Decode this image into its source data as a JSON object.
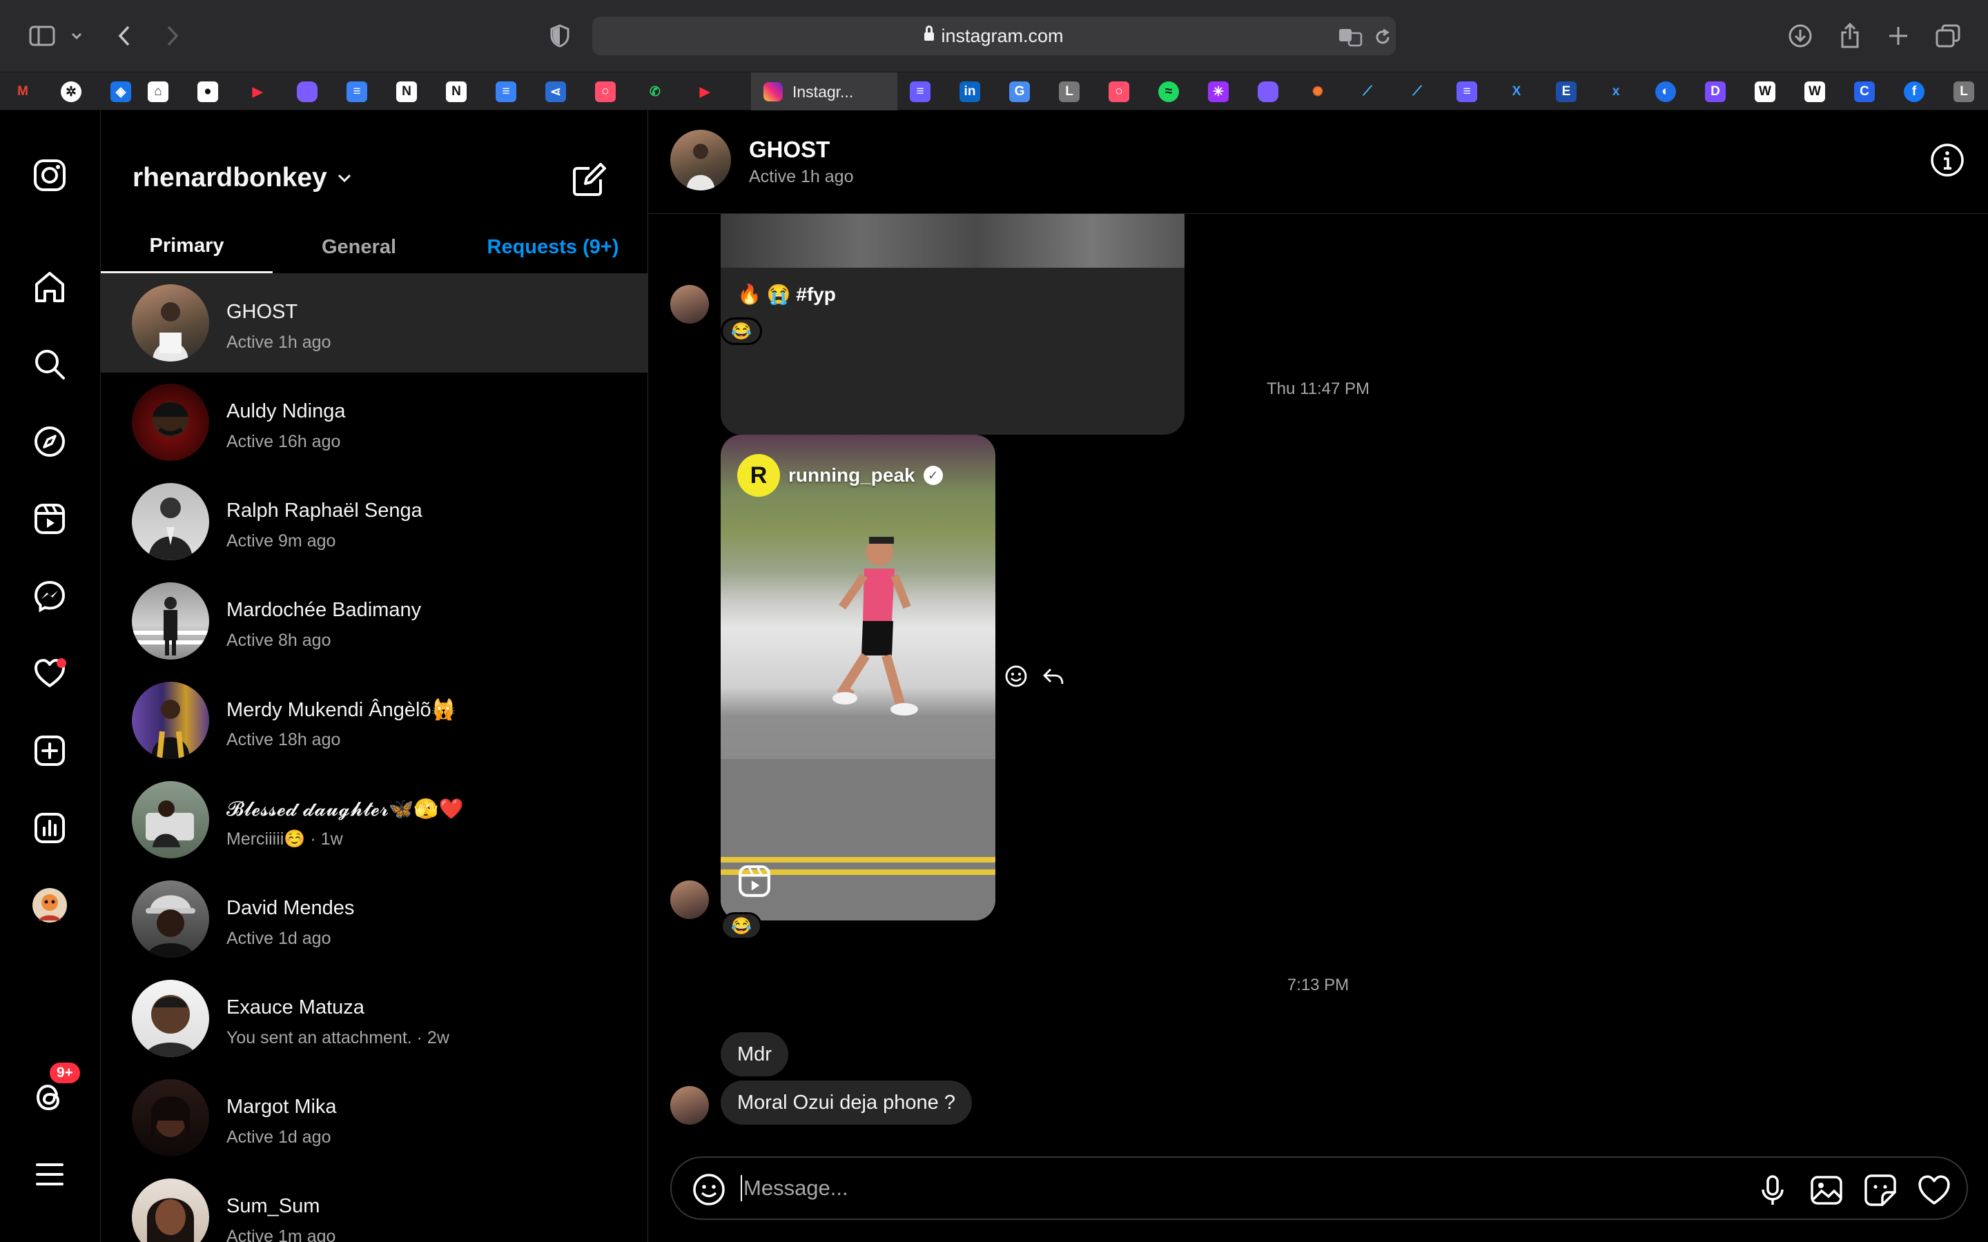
{
  "browser": {
    "url": "instagram.com",
    "active_tab_title": "Instagr..."
  },
  "nav": {
    "items": [
      "instagram-logo",
      "home",
      "search",
      "explore",
      "reels",
      "messages",
      "notifications",
      "create",
      "dashboard",
      "profile",
      "threads",
      "more"
    ],
    "threads_badge": "9+"
  },
  "inbox": {
    "username": "rhenardbonkey",
    "tabs": {
      "primary": "Primary",
      "general": "General",
      "requests": "Requests (9+)"
    },
    "conversations": [
      {
        "name": "GHOST",
        "status": "Active 1h ago"
      },
      {
        "name": "Auldy Ndinga",
        "status": "Active 16h ago"
      },
      {
        "name": "Ralph Raphaël Senga",
        "status": "Active 9m ago"
      },
      {
        "name": "Mardochée Badimany",
        "status": "Active 8h ago"
      },
      {
        "name": "Merdy Mukendi Ângèlõ🙀",
        "status": "Active 18h ago"
      },
      {
        "name": "𝓑𝓵𝓮𝓼𝓼𝓮𝓭 𝓭𝓪𝓾𝓰𝓱𝓽𝓮𝓻🦋🫣❤️",
        "status": "Merciiiii☺️ · 1w"
      },
      {
        "name": "David Mendes",
        "status": "Active 1d ago"
      },
      {
        "name": "Exauce Matuza",
        "status": "You sent an attachment. · 2w"
      },
      {
        "name": "Margot Mika",
        "status": "Active 1d ago"
      },
      {
        "name": "Sum_Sum",
        "status": "Active 1m ago"
      }
    ]
  },
  "chat": {
    "name": "GHOST",
    "status": "Active 1h ago",
    "post_caption": "🔥 😭 #fyp",
    "reaction": "😂",
    "timestamp_1": "Thu 11:47 PM",
    "reel_username": "running_peak",
    "timestamp_2": "7:13 PM",
    "messages": [
      "Mdr",
      "Moral Ozui deja phone ?"
    ],
    "composer_placeholder": "Message..."
  }
}
